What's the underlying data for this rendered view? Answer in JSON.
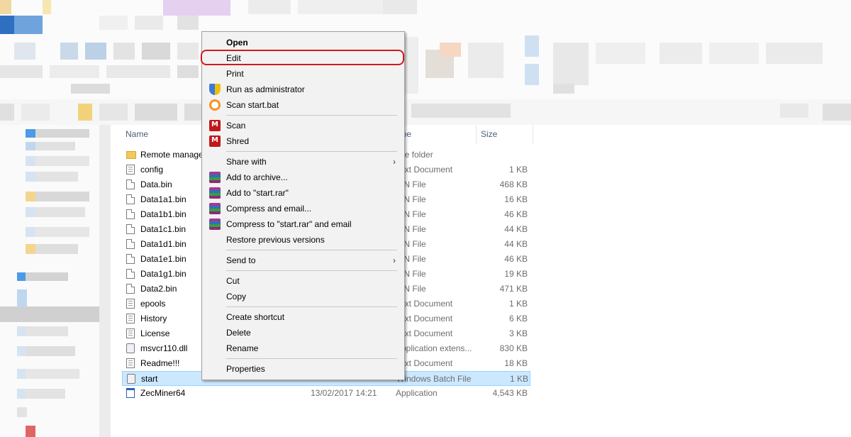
{
  "file_list": {
    "columns": {
      "name": "Name",
      "type": "Type",
      "size": "Size"
    },
    "rows": [
      {
        "name": "Remote manage",
        "date": "",
        "type": "File folder",
        "size": "",
        "icon": "folder-icon"
      },
      {
        "name": "config",
        "date": "",
        "type": "Text Document",
        "size": "1 KB",
        "icon": "text-file-icon"
      },
      {
        "name": "Data.bin",
        "date": "",
        "type": "BIN File",
        "size": "468 KB",
        "icon": "file-icon"
      },
      {
        "name": "Data1a1.bin",
        "date": "",
        "type": "BIN File",
        "size": "16 KB",
        "icon": "file-icon"
      },
      {
        "name": "Data1b1.bin",
        "date": "",
        "type": "BIN File",
        "size": "46 KB",
        "icon": "file-icon"
      },
      {
        "name": "Data1c1.bin",
        "date": "",
        "type": "BIN File",
        "size": "44 KB",
        "icon": "file-icon"
      },
      {
        "name": "Data1d1.bin",
        "date": "",
        "type": "BIN File",
        "size": "44 KB",
        "icon": "file-icon"
      },
      {
        "name": "Data1e1.bin",
        "date": "",
        "type": "BIN File",
        "size": "46 KB",
        "icon": "file-icon"
      },
      {
        "name": "Data1g1.bin",
        "date": "",
        "type": "BIN File",
        "size": "19 KB",
        "icon": "file-icon"
      },
      {
        "name": "Data2.bin",
        "date": "",
        "type": "BIN File",
        "size": "471 KB",
        "icon": "file-icon"
      },
      {
        "name": "epools",
        "date": "",
        "type": "Text Document",
        "size": "1 KB",
        "icon": "text-file-icon"
      },
      {
        "name": "History",
        "date": "",
        "type": "Text Document",
        "size": "6 KB",
        "icon": "text-file-icon"
      },
      {
        "name": "License",
        "date": "",
        "type": "Text Document",
        "size": "3 KB",
        "icon": "text-file-icon"
      },
      {
        "name": "msvcr110.dll",
        "date": "",
        "type": "Application extens...",
        "size": "830 KB",
        "icon": "dll-icon"
      },
      {
        "name": "Readme!!!",
        "date": "",
        "type": "Text Document",
        "size": "18 KB",
        "icon": "text-file-icon"
      },
      {
        "name": "start",
        "date": "",
        "type": "Windows Batch File",
        "size": "1 KB",
        "icon": "batch-file-icon",
        "selected": true
      },
      {
        "name": "ZecMiner64",
        "date": "13/02/2017 14:21",
        "type": "Application",
        "size": "4,543 KB",
        "icon": "application-icon"
      }
    ]
  },
  "context_menu": {
    "items": [
      {
        "label": "Open",
        "bold": true
      },
      {
        "label": "Edit",
        "highlighted": true
      },
      {
        "label": "Print"
      },
      {
        "label": "Run as administrator",
        "icon": "uac-shield-icon"
      },
      {
        "label": "Scan start.bat",
        "icon": "avast-icon"
      },
      {
        "separator": true
      },
      {
        "label": "Scan",
        "icon": "mcafee-icon"
      },
      {
        "label": "Shred",
        "icon": "mcafee-icon"
      },
      {
        "separator": true
      },
      {
        "label": "Share with",
        "submenu": true
      },
      {
        "label": "Add to archive...",
        "icon": "winrar-icon"
      },
      {
        "label": "Add to \"start.rar\"",
        "icon": "winrar-icon"
      },
      {
        "label": "Compress and email...",
        "icon": "winrar-icon"
      },
      {
        "label": "Compress to \"start.rar\" and email",
        "icon": "winrar-icon"
      },
      {
        "label": "Restore previous versions"
      },
      {
        "separator": true
      },
      {
        "label": "Send to",
        "submenu": true
      },
      {
        "separator": true
      },
      {
        "label": "Cut"
      },
      {
        "label": "Copy"
      },
      {
        "separator": true
      },
      {
        "label": "Create shortcut"
      },
      {
        "label": "Delete"
      },
      {
        "label": "Rename"
      },
      {
        "separator": true
      },
      {
        "label": "Properties"
      }
    ],
    "submenu_arrow": "›"
  },
  "colors": {
    "highlight_ring": "#d11a1a",
    "selection_bg": "#cce8ff",
    "header_text": "#4c607a"
  }
}
